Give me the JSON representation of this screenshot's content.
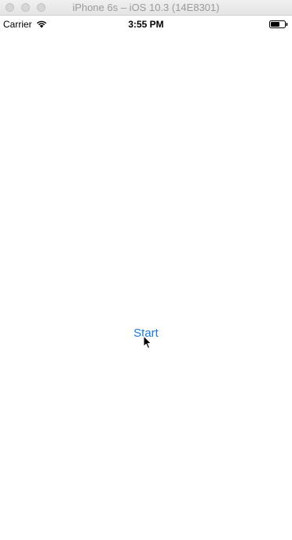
{
  "window": {
    "title": "iPhone 6s – iOS 10.3 (14E8301)",
    "buttons": [
      "close",
      "minimize",
      "zoom"
    ]
  },
  "status_bar": {
    "carrier": "Carrier",
    "time": "3:55 PM",
    "icons": [
      "wifi-icon",
      "battery-icon"
    ]
  },
  "main": {
    "start_label": "Start",
    "accent_color": "#1a7ad8"
  }
}
